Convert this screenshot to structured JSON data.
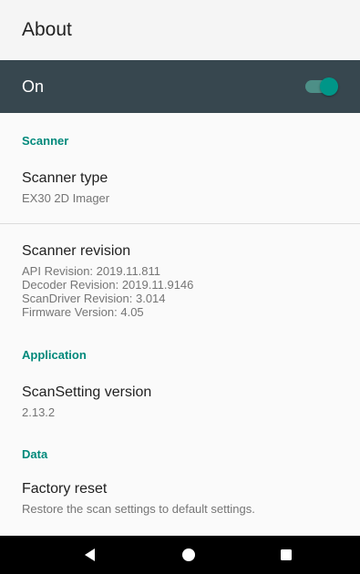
{
  "app_bar": {
    "title": "About"
  },
  "master_switch": {
    "label": "On",
    "state": "on",
    "accent_color": "#009688"
  },
  "sections": {
    "scanner": {
      "header": "Scanner",
      "scanner_type": {
        "title": "Scanner type",
        "summary": "EX30 2D Imager"
      },
      "scanner_revision": {
        "title": "Scanner revision",
        "lines": [
          "API Revision: 2019.11.811",
          "Decoder Revision: 2019.11.9146",
          "ScanDriver Revision: 3.014",
          "Firmware Version: 4.05"
        ]
      }
    },
    "application": {
      "header": "Application",
      "scansetting_version": {
        "title": "ScanSetting version",
        "summary": "2.13.2"
      }
    },
    "data": {
      "header": "Data",
      "factory_reset": {
        "title": "Factory reset",
        "summary": "Restore the scan settings to default settings."
      }
    }
  },
  "nav_bar": {
    "back_icon": "back-triangle-icon",
    "home_icon": "home-circle-icon",
    "recents_icon": "recents-square-icon"
  }
}
